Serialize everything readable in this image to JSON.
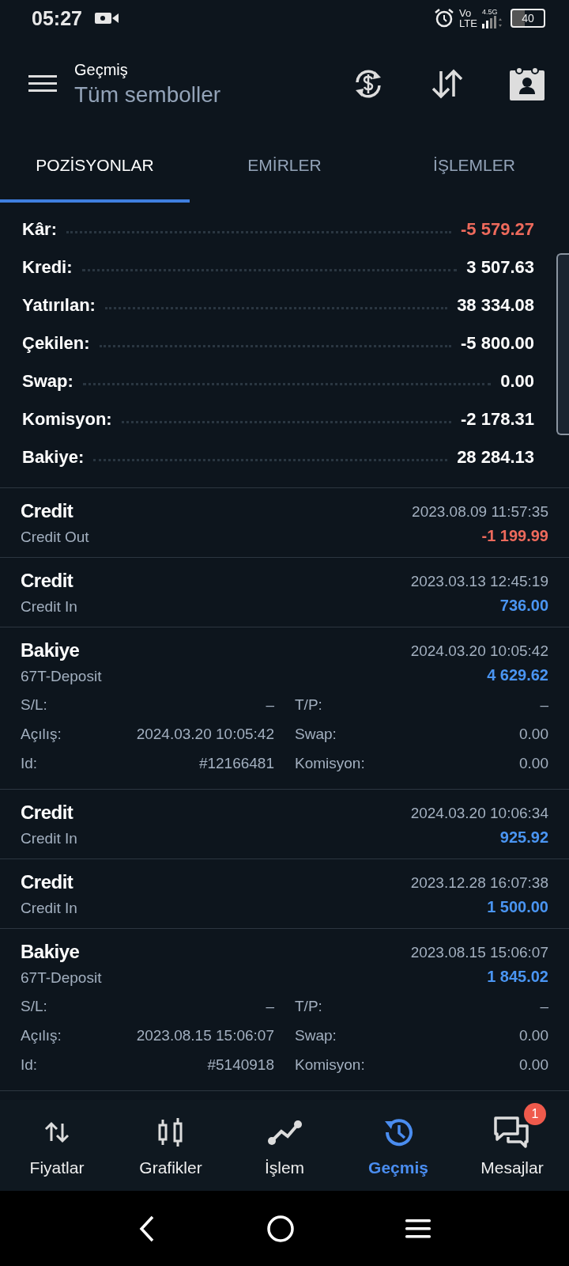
{
  "status_bar": {
    "time": "05:27",
    "network_top": "Vo",
    "network_bottom": "LTE",
    "generation": "4.5G",
    "battery": "40"
  },
  "header": {
    "title": "Geçmiş",
    "subtitle": "Tüm semboller"
  },
  "tabs": [
    {
      "label": "POZİSYONLAR",
      "selected": true
    },
    {
      "label": "EMİRLER",
      "selected": false
    },
    {
      "label": "İŞLEMLER",
      "selected": false
    }
  ],
  "summary": [
    {
      "label": "Kâr:",
      "value": "-5 579.27",
      "color": "#ee6a5c"
    },
    {
      "label": "Kredi:",
      "value": "3 507.63",
      "color": "#ffffff"
    },
    {
      "label": "Yatırılan:",
      "value": "38 334.08",
      "color": "#ffffff"
    },
    {
      "label": "Çekilen:",
      "value": "-5 800.00",
      "color": "#ffffff"
    },
    {
      "label": "Swap:",
      "value": "0.00",
      "color": "#ffffff"
    },
    {
      "label": "Komisyon:",
      "value": "-2 178.31",
      "color": "#ffffff"
    },
    {
      "label": "Bakiye:",
      "value": "28 284.13",
      "color": "#ffffff"
    }
  ],
  "deals": [
    {
      "kind": "simple",
      "title": "Credit",
      "subtitle": "Credit Out",
      "time": "2023.08.09 11:57:35",
      "amount": "-1 199.99",
      "color": "#ee6a5c"
    },
    {
      "kind": "simple",
      "title": "Credit",
      "subtitle": "Credit In",
      "time": "2023.03.13 12:45:19",
      "amount": "736.00",
      "color": "#4a95f2"
    },
    {
      "kind": "detailed",
      "title": "Bakiye",
      "subtitle": "67T-Deposit",
      "time": "2024.03.20 10:05:42",
      "amount": "4 629.62",
      "color": "#4a95f2",
      "fields": [
        {
          "label": "S/L:",
          "value": "–"
        },
        {
          "label": "T/P:",
          "value": "–"
        },
        {
          "label": "Açılış:",
          "value": "2024.03.20 10:05:42"
        },
        {
          "label": "Swap:",
          "value": "0.00"
        },
        {
          "label": "Id:",
          "value": "#12166481"
        },
        {
          "label": "Komisyon:",
          "value": "0.00"
        }
      ]
    },
    {
      "kind": "simple",
      "title": "Credit",
      "subtitle": "Credit In",
      "time": "2024.03.20 10:06:34",
      "amount": "925.92",
      "color": "#4a95f2"
    },
    {
      "kind": "simple",
      "title": "Credit",
      "subtitle": "Credit In",
      "time": "2023.12.28 16:07:38",
      "amount": "1 500.00",
      "color": "#4a95f2"
    },
    {
      "kind": "detailed",
      "title": "Bakiye",
      "subtitle": "67T-Deposit",
      "time": "2023.08.15 15:06:07",
      "amount": "1 845.02",
      "color": "#4a95f2",
      "fields": [
        {
          "label": "S/L:",
          "value": "–"
        },
        {
          "label": "T/P:",
          "value": "–"
        },
        {
          "label": "Açılış:",
          "value": "2023.08.15 15:06:07"
        },
        {
          "label": "Swap:",
          "value": "0.00"
        },
        {
          "label": "Id:",
          "value": "#5140918"
        },
        {
          "label": "Komisyon:",
          "value": "0.00"
        }
      ]
    }
  ],
  "bottom_nav": [
    {
      "label": "Fiyatlar",
      "selected": false
    },
    {
      "label": "Grafikler",
      "selected": false
    },
    {
      "label": "İşlem",
      "selected": false
    },
    {
      "label": "Geçmiş",
      "selected": true
    },
    {
      "label": "Mesajlar",
      "selected": false,
      "badge": "1"
    }
  ]
}
